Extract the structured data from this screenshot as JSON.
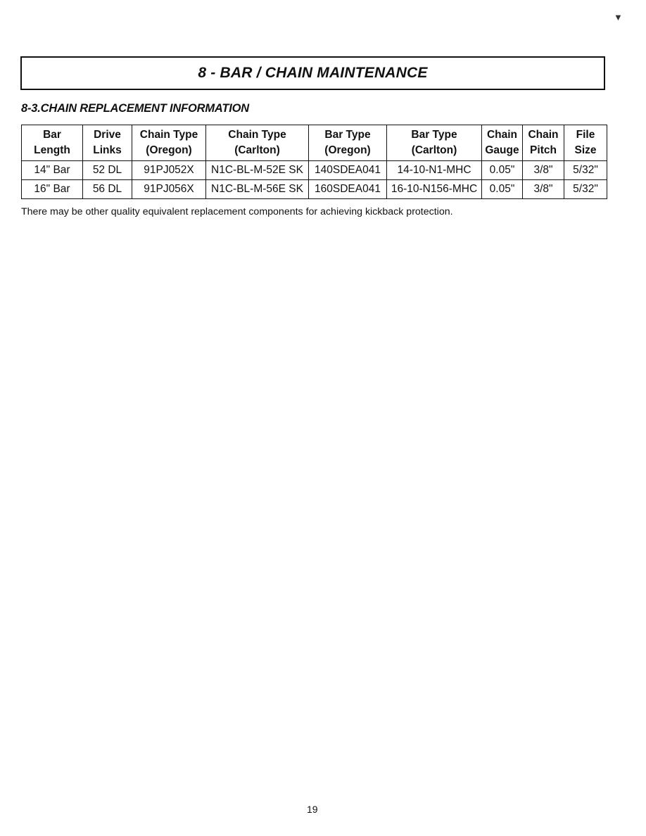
{
  "section": {
    "title": "8 - BAR / CHAIN MAINTENANCE"
  },
  "subsection": {
    "title": "8-3.CHAIN REPLACEMENT INFORMATION"
  },
  "table": {
    "columns": [
      {
        "line1": "Bar",
        "line2": "Length"
      },
      {
        "line1": "Drive",
        "line2": "Links"
      },
      {
        "line1": "Chain Type",
        "line2": "(Oregon)"
      },
      {
        "line1": "Chain Type",
        "line2": "(Carlton)"
      },
      {
        "line1": "Bar Type",
        "line2": "(Oregon)"
      },
      {
        "line1": "Bar Type",
        "line2": "(Carlton)"
      },
      {
        "line1": "Chain",
        "line2": "Gauge"
      },
      {
        "line1": "Chain",
        "line2": "Pitch"
      },
      {
        "line1": "File",
        "line2": "Size"
      }
    ],
    "rows": [
      [
        "14\" Bar",
        "52 DL",
        "91PJ052X",
        "N1C-BL-M-52E SK",
        "140SDEA041",
        "14-10-N1-MHC",
        "0.05\"",
        "3/8\"",
        "5/32\""
      ],
      [
        "16\" Bar",
        "56 DL",
        "91PJ056X",
        "N1C-BL-M-56E SK",
        "160SDEA041",
        "16-10-N156-MHC",
        "0.05\"",
        "3/8\"",
        "5/32\""
      ]
    ]
  },
  "note": "There may be other quality equivalent replacement components for achieving kickback protection.",
  "page_number": "19",
  "icons": {
    "corner_mark": "scan-artifact-icon"
  }
}
